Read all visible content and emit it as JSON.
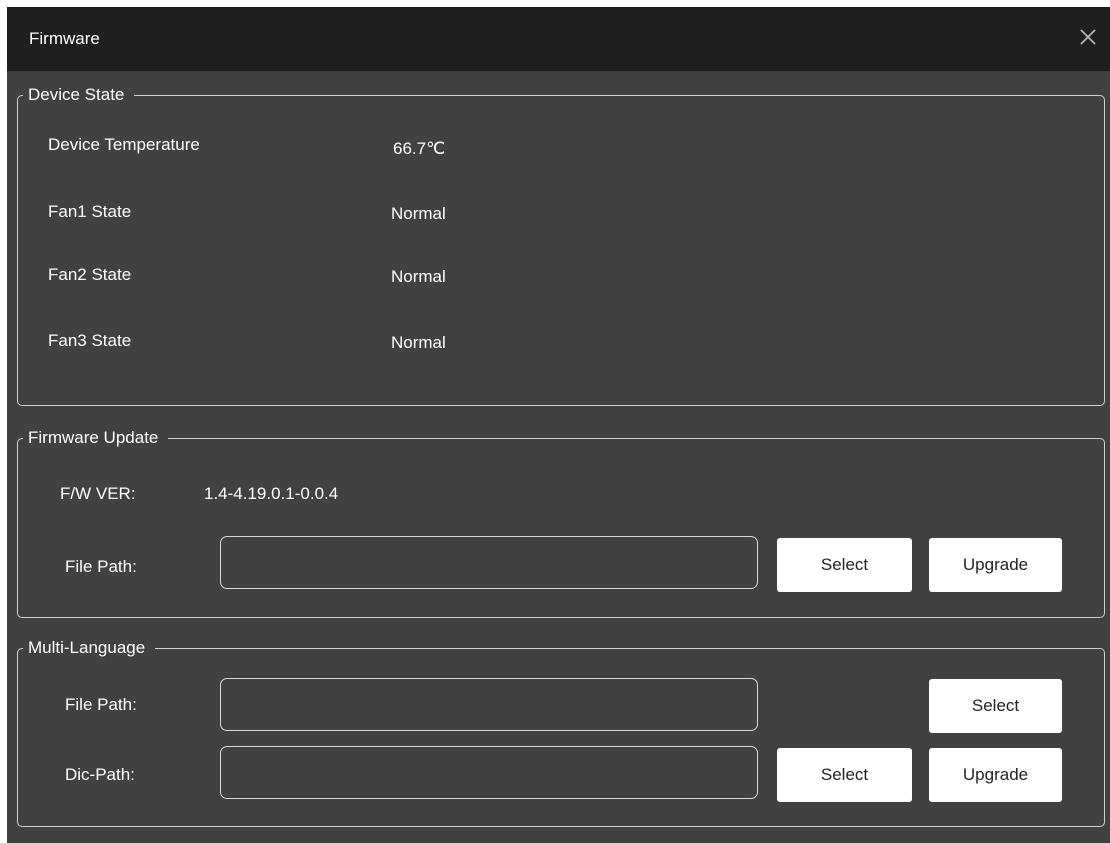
{
  "window": {
    "title": "Firmware",
    "close_icon": "close-icon"
  },
  "device_state": {
    "legend": "Device State",
    "rows": [
      {
        "label": "Device Temperature",
        "value": "66.7℃"
      },
      {
        "label": "Fan1 State",
        "value": "Normal"
      },
      {
        "label": "Fan2 State",
        "value": "Normal"
      },
      {
        "label": "Fan3 State",
        "value": "Normal"
      }
    ]
  },
  "firmware_update": {
    "legend": "Firmware Update",
    "version_label": "F/W VER:",
    "version_value": "1.4-4.19.0.1-0.0.4",
    "file_path_label": "File Path:",
    "file_path_value": "",
    "select_label": "Select",
    "upgrade_label": "Upgrade"
  },
  "multi_language": {
    "legend": "Multi-Language",
    "file_path_label": "File Path:",
    "file_path_value": "",
    "file_select_label": "Select",
    "dic_path_label": "Dic-Path:",
    "dic_path_value": "",
    "dic_select_label": "Select",
    "upgrade_label": "Upgrade"
  },
  "colors": {
    "titlebar": "#1f1f1f",
    "panel": "#414141",
    "border": "#d0d0d0",
    "text": "#ffffff",
    "button_bg": "#ffffff"
  }
}
